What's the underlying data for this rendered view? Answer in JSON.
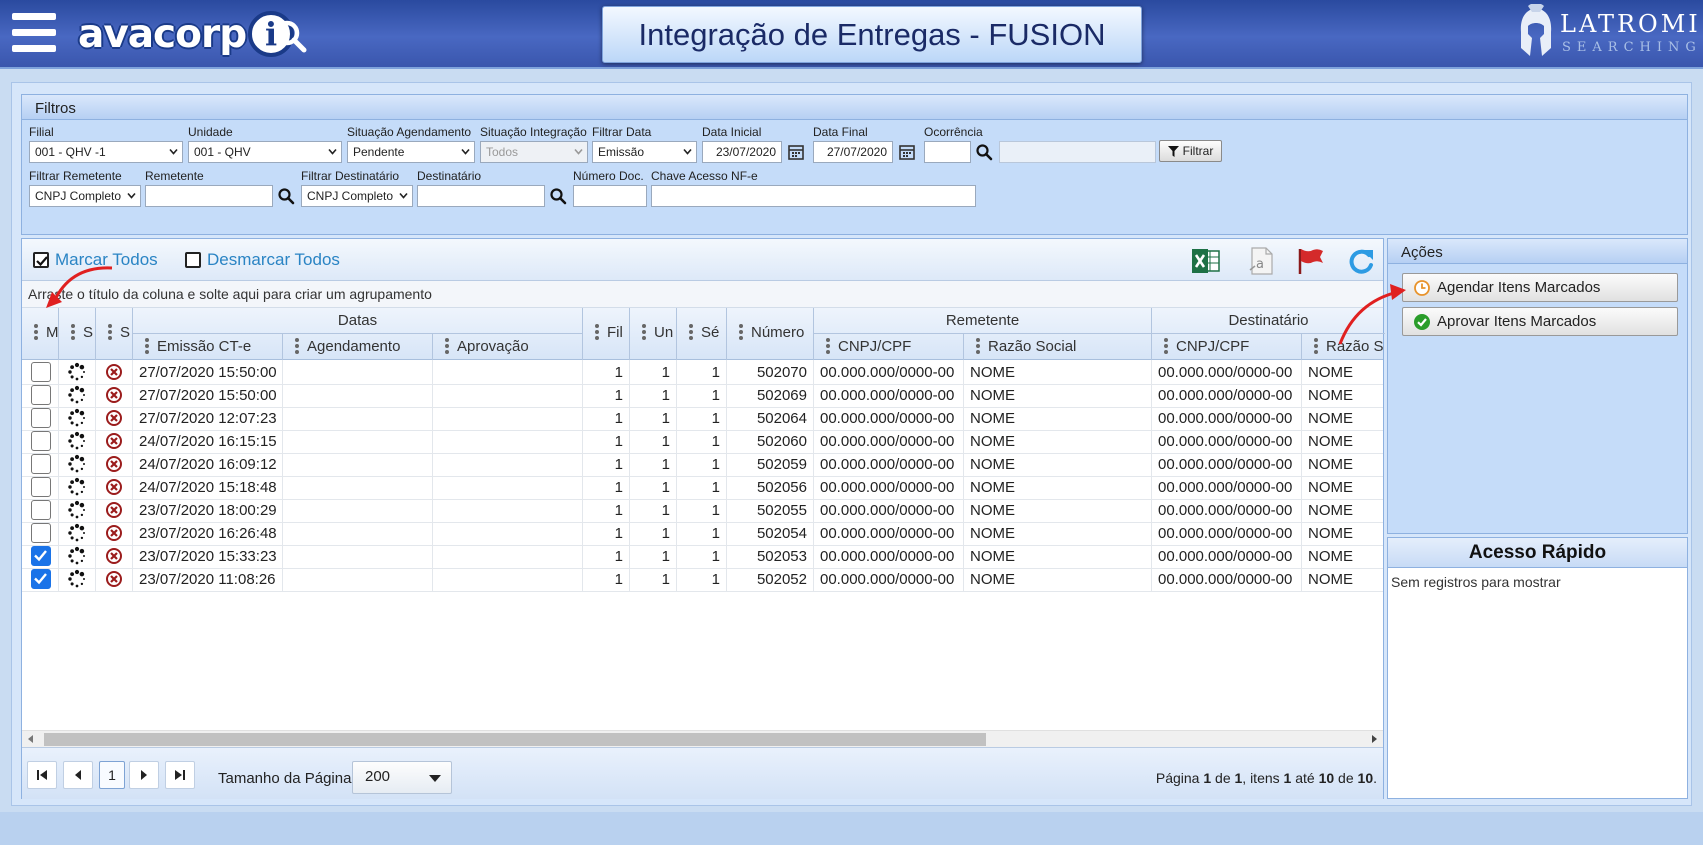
{
  "app": {
    "logo_text": "avacorp",
    "logo_i": "i",
    "title": "Integração de Entregas - FUSION",
    "brand_name": "LATROMI",
    "brand_sub": "SEARCHING"
  },
  "filters": {
    "heading": "Filtros",
    "filial": {
      "label": "Filial",
      "value": "001 - QHV -1"
    },
    "unidade": {
      "label": "Unidade",
      "value": "001 - QHV"
    },
    "situacao_agendamento": {
      "label": "Situação Agendamento",
      "value": "Pendente"
    },
    "situacao_integracao": {
      "label": "Situação Integração",
      "value": "Todos"
    },
    "filtrar_data": {
      "label": "Filtrar Data",
      "value": "Emissão"
    },
    "data_inicial": {
      "label": "Data Inicial",
      "value": "23/07/2020"
    },
    "data_final": {
      "label": "Data Final",
      "value": "27/07/2020"
    },
    "ocorrencia": {
      "label": "Ocorrência",
      "value": "",
      "desc": ""
    },
    "filtrar_button": "Filtrar",
    "filtrar_remetente": {
      "label": "Filtrar Remetente",
      "value": "CNPJ Completo"
    },
    "remetente": {
      "label": "Remetente",
      "value": ""
    },
    "filtrar_destinatario": {
      "label": "Filtrar Destinatário",
      "value": "CNPJ Completo"
    },
    "destinatario": {
      "label": "Destinatário",
      "value": ""
    },
    "numero_doc": {
      "label": "Número Doc.",
      "value": ""
    },
    "chave_acesso": {
      "label": "Chave Acesso NF-e",
      "value": ""
    }
  },
  "grid": {
    "marcar_todos": "Marcar Todos",
    "desmarcar_todos": "Desmarcar Todos",
    "group_hint": "Arraste o título da coluna e solte aqui para criar um agrupamento",
    "toolbar_icons": [
      "excel-export-icon",
      "text-export-icon",
      "flag-icon",
      "refresh-icon"
    ],
    "headers": {
      "m": "M",
      "s1": "S",
      "s2": "S",
      "datas": "Datas",
      "emissao": "Emissão CT-e",
      "agendamento": "Agendamento",
      "aprovacao": "Aprovação",
      "filial": "Fil",
      "unidade": "Un",
      "serie": "Sé",
      "numero": "Número",
      "remetente": "Remetente",
      "rem_cnpj": "CNPJ/CPF",
      "rem_razao": "Razão Social",
      "destinatario": "Destinatário",
      "dest_cnpj": "CNPJ/CPF",
      "dest_razao": "Razão S"
    },
    "rows": [
      {
        "checked": false,
        "emissao": "27/07/2020 15:50:00",
        "agendamento": "",
        "aprovacao": "",
        "filial": "1",
        "unidade": "1",
        "serie": "1",
        "numero": "502070",
        "rem_cnpj": "00.000.000/0000-00",
        "rem_razao": "NOME",
        "dest_cnpj": "00.000.000/0000-00",
        "dest_razao": "NOME"
      },
      {
        "checked": false,
        "emissao": "27/07/2020 15:50:00",
        "agendamento": "",
        "aprovacao": "",
        "filial": "1",
        "unidade": "1",
        "serie": "1",
        "numero": "502069",
        "rem_cnpj": "00.000.000/0000-00",
        "rem_razao": "NOME",
        "dest_cnpj": "00.000.000/0000-00",
        "dest_razao": "NOME"
      },
      {
        "checked": false,
        "emissao": "27/07/2020 12:07:23",
        "agendamento": "",
        "aprovacao": "",
        "filial": "1",
        "unidade": "1",
        "serie": "1",
        "numero": "502064",
        "rem_cnpj": "00.000.000/0000-00",
        "rem_razao": "NOME",
        "dest_cnpj": "00.000.000/0000-00",
        "dest_razao": "NOME"
      },
      {
        "checked": false,
        "emissao": "24/07/2020 16:15:15",
        "agendamento": "",
        "aprovacao": "",
        "filial": "1",
        "unidade": "1",
        "serie": "1",
        "numero": "502060",
        "rem_cnpj": "00.000.000/0000-00",
        "rem_razao": "NOME",
        "dest_cnpj": "00.000.000/0000-00",
        "dest_razao": "NOME"
      },
      {
        "checked": false,
        "emissao": "24/07/2020 16:09:12",
        "agendamento": "",
        "aprovacao": "",
        "filial": "1",
        "unidade": "1",
        "serie": "1",
        "numero": "502059",
        "rem_cnpj": "00.000.000/0000-00",
        "rem_razao": "NOME",
        "dest_cnpj": "00.000.000/0000-00",
        "dest_razao": "NOME"
      },
      {
        "checked": false,
        "emissao": "24/07/2020 15:18:48",
        "agendamento": "",
        "aprovacao": "",
        "filial": "1",
        "unidade": "1",
        "serie": "1",
        "numero": "502056",
        "rem_cnpj": "00.000.000/0000-00",
        "rem_razao": "NOME",
        "dest_cnpj": "00.000.000/0000-00",
        "dest_razao": "NOME"
      },
      {
        "checked": false,
        "emissao": "23/07/2020 18:00:29",
        "agendamento": "",
        "aprovacao": "",
        "filial": "1",
        "unidade": "1",
        "serie": "1",
        "numero": "502055",
        "rem_cnpj": "00.000.000/0000-00",
        "rem_razao": "NOME",
        "dest_cnpj": "00.000.000/0000-00",
        "dest_razao": "NOME"
      },
      {
        "checked": false,
        "emissao": "23/07/2020 16:26:48",
        "agendamento": "",
        "aprovacao": "",
        "filial": "1",
        "unidade": "1",
        "serie": "1",
        "numero": "502054",
        "rem_cnpj": "00.000.000/0000-00",
        "rem_razao": "NOME",
        "dest_cnpj": "00.000.000/0000-00",
        "dest_razao": "NOME"
      },
      {
        "checked": true,
        "emissao": "23/07/2020 15:33:23",
        "agendamento": "",
        "aprovacao": "",
        "filial": "1",
        "unidade": "1",
        "serie": "1",
        "numero": "502053",
        "rem_cnpj": "00.000.000/0000-00",
        "rem_razao": "NOME",
        "dest_cnpj": "00.000.000/0000-00",
        "dest_razao": "NOME"
      },
      {
        "checked": true,
        "emissao": "23/07/2020 11:08:26",
        "agendamento": "",
        "aprovacao": "",
        "filial": "1",
        "unidade": "1",
        "serie": "1",
        "numero": "502052",
        "rem_cnpj": "00.000.000/0000-00",
        "rem_razao": "NOME",
        "dest_cnpj": "00.000.000/0000-00",
        "dest_razao": "NOME"
      }
    ]
  },
  "pager": {
    "current_page": "1",
    "page_size_label": "Tamanho da Página",
    "page_size": "200",
    "info_prefix": "Página ",
    "page": "1",
    "of": " de ",
    "pages": "1",
    "items_prefix": ", itens ",
    "from": "1",
    "to_word": " até ",
    "to": "10",
    "total_word": " de ",
    "total": "10",
    "suffix": "."
  },
  "actions": {
    "heading": "Ações",
    "agendar": "Agendar Itens Marcados",
    "aprovar": "Aprovar Itens Marcados"
  },
  "quick_access": {
    "heading": "Acesso Rápido",
    "empty": "Sem registros para mostrar"
  },
  "colors": {
    "accent_link": "#2a84c4",
    "header_blue": "#3a56ad",
    "error_red": "#9b1c1c",
    "check_blue": "#1a73e8",
    "approve_green": "#2a9d2a",
    "clock_orange": "#e8932b",
    "annotation_red": "#e02020"
  }
}
